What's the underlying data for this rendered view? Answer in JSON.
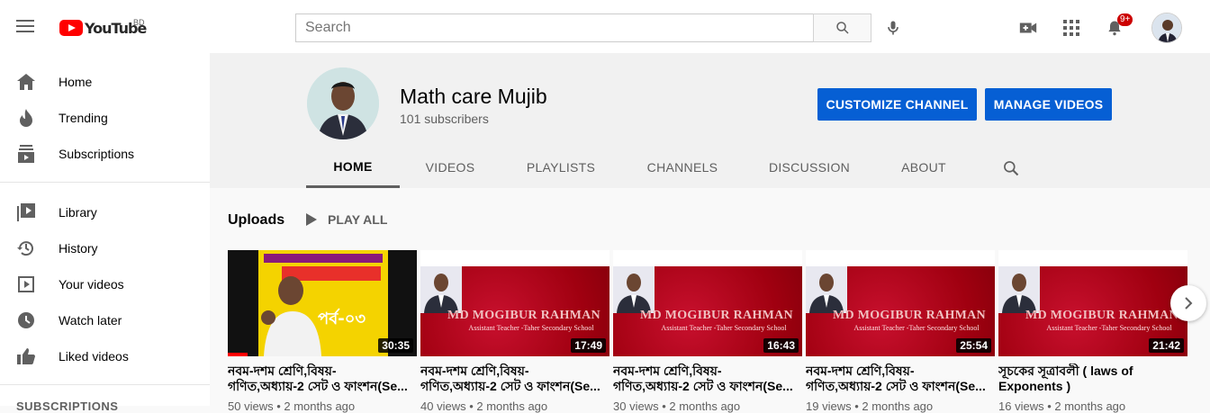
{
  "topbar": {
    "logo_text": "YouTube",
    "country": "BD",
    "search_placeholder": "Search",
    "notifications_badge": "9+"
  },
  "sidebar": {
    "items": [
      {
        "label": "Home",
        "icon": "home-icon"
      },
      {
        "label": "Trending",
        "icon": "trending-icon"
      },
      {
        "label": "Subscriptions",
        "icon": "subscriptions-icon"
      },
      {
        "label": "Library",
        "icon": "library-icon"
      },
      {
        "label": "History",
        "icon": "history-icon"
      },
      {
        "label": "Your videos",
        "icon": "your-videos-icon"
      },
      {
        "label": "Watch later",
        "icon": "watch-later-icon"
      },
      {
        "label": "Liked videos",
        "icon": "liked-videos-icon"
      }
    ],
    "section_label": "SUBSCRIPTIONS"
  },
  "channel": {
    "name": "Math care Mujib",
    "subscribers": "101 subscribers",
    "customize_label": "CUSTOMIZE CHANNEL",
    "manage_label": "MANAGE VIDEOS",
    "tabs": [
      "HOME",
      "VIDEOS",
      "PLAYLISTS",
      "CHANNELS",
      "DISCUSSION",
      "ABOUT"
    ]
  },
  "uploads": {
    "title": "Uploads",
    "play_all": "PLAY ALL",
    "videos": [
      {
        "title": "নবম-দশম শ্রেণি,বিষয়-গণিত,অধ্যায়-2 সেট ও ফাংশন(Se...",
        "duration": "30:35",
        "meta": "50 views • 2 months ago"
      },
      {
        "title": "নবম-দশম শ্রেণি,বিষয়-গণিত,অধ্যায়-2 সেট ও ফাংশন(Se...",
        "duration": "17:49",
        "meta": "40 views • 2 months ago"
      },
      {
        "title": "নবম-দশম শ্রেণি,বিষয়-গণিত,অধ্যায়-2 সেট ও ফাংশন(Se...",
        "duration": "16:43",
        "meta": "30 views • 2 months ago"
      },
      {
        "title": "নবম-দশম শ্রেণি,বিষয়-গণিত,অধ্যায়-2 সেট ও ফাংশন(Se...",
        "duration": "25:54",
        "meta": "19 views • 2 months ago"
      },
      {
        "title": "সূচকের সূত্রাবলী ( laws of Exponents )",
        "duration": "21:42",
        "meta": "16 views • 2 months ago"
      }
    ],
    "banner_name": "MD MOGIBUR RAHMAN",
    "banner_sub": "Assistant Teacher -Taher Secondary School",
    "first_thumb_text": "পর্ব-০৩"
  },
  "colors": {
    "brand_red": "#ff0000",
    "button_blue": "#065fd4"
  }
}
